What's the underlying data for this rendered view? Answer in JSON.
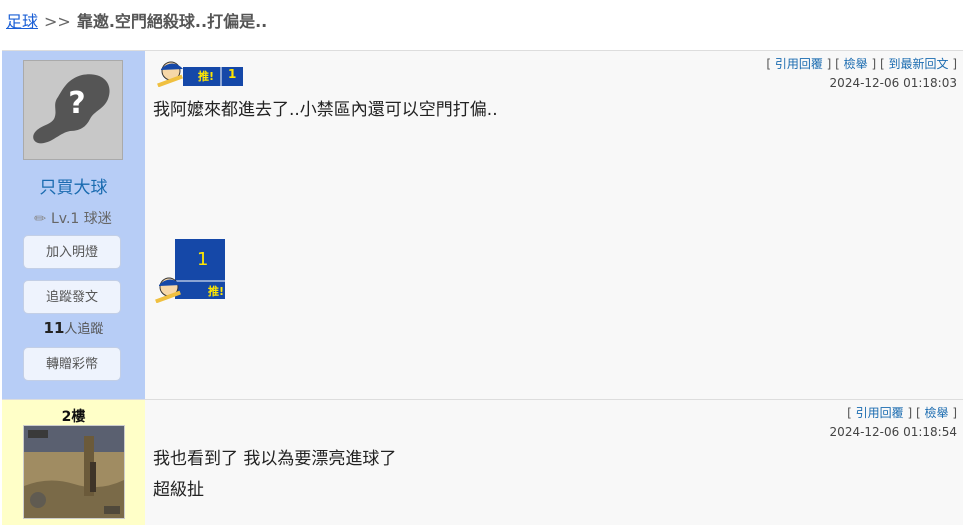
{
  "breadcrumb": {
    "board": "足球",
    "separator": ">>",
    "title": "靠邀.空門絕殺球..打偏是.."
  },
  "posts": [
    {
      "username": "只買大球",
      "level": "Lv.1 球迷",
      "buttons": {
        "light": "加入明燈",
        "follow": "追蹤發文",
        "gift": "轉贈彩幣"
      },
      "followers_count": "11",
      "followers_suffix": "人追蹤",
      "links": {
        "quote": "引用回覆",
        "report": "檢舉",
        "latest": "到最新回文"
      },
      "timestamp": "2024-12-06 01:18:03",
      "content": "我阿嬤來都進去了..小禁區內還可以空門打偏..",
      "push_label": "推!",
      "push_count": "1"
    },
    {
      "floor": "2樓",
      "links": {
        "quote": "引用回覆",
        "report": "檢舉"
      },
      "timestamp": "2024-12-06 01:18:54",
      "content_line1": "我也看到了 我以為要漂亮進球了",
      "content_line2": "超級扯"
    }
  ],
  "colors": {
    "sidebar_user": "#b7cdf6",
    "sidebar_floor2": "#ffffc8",
    "link": "#1a6bb0",
    "push_blue": "#1548a8",
    "push_yellow": "#ffe600"
  }
}
